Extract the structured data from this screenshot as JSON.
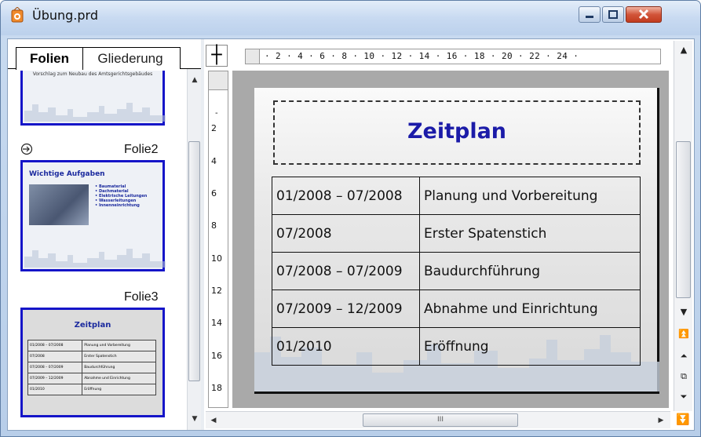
{
  "window": {
    "title": "Übung.prd"
  },
  "left_panel": {
    "tabs": [
      "Folien",
      "Gliederung"
    ],
    "slide1_text": "Vorschlag zum Neubau des Amtsgerichtsgebäudes",
    "slide2": {
      "label": "Folie2",
      "title": "Wichtige Aufgaben",
      "bullets": [
        "Baumaterial",
        "Dachmaterial",
        "Elektrische Leitungen",
        "Wasserleitungen",
        "Innenneinrichtung"
      ]
    },
    "slide3": {
      "label": "Folie3",
      "title": "Zeitplan"
    }
  },
  "ruler": {
    "h_labels": "· 2 · 4 · 6 · 8 · 10 · 12 · 14 · 16 · 18 · 20 · 22 · 24 ·",
    "v_labels": [
      "2",
      "4",
      "6",
      "8",
      "10",
      "12",
      "14",
      "16",
      "18"
    ]
  },
  "slide": {
    "title": "Zeitplan",
    "rows": [
      [
        "01/2008 – 07/2008",
        "Planung und Vorbereitung"
      ],
      [
        "07/2008",
        "Erster Spatenstich"
      ],
      [
        "07/2008 – 07/2009",
        "Baudurchführung"
      ],
      [
        "07/2009 – 12/2009",
        "Abnahme und Einrichtung"
      ],
      [
        "01/2010",
        "Eröffnung"
      ]
    ]
  },
  "scroll": {
    "h_thumb_grip": "III"
  },
  "colors": {
    "accent": "#1b1ba8",
    "thumb_border": "#1515c8"
  }
}
